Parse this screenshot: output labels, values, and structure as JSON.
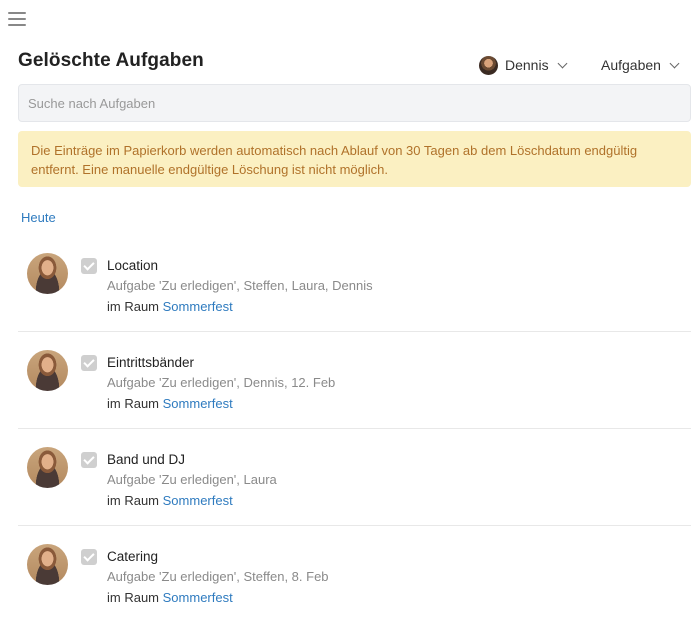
{
  "header": {
    "title": "Gelöschte Aufgaben",
    "user_filter": {
      "label": "Dennis"
    },
    "type_filter": {
      "label": "Aufgaben"
    }
  },
  "search": {
    "placeholder": "Suche nach Aufgaben",
    "value": ""
  },
  "notice": {
    "text": "Die Einträge im Papierkorb werden automatisch nach Ablauf von 30 Tagen ab dem Löschdatum endgültig entfernt. Eine manuelle endgültige Löschung ist nicht möglich."
  },
  "groups": [
    {
      "label": "Heute",
      "items": [
        {
          "title": "Location",
          "meta": "Aufgabe 'Zu erledigen', Steffen, Laura, Dennis",
          "room_prefix": "im Raum",
          "room": "Sommerfest"
        },
        {
          "title": "Eintrittsbänder",
          "meta": "Aufgabe 'Zu erledigen', Dennis, 12. Feb",
          "room_prefix": "im Raum",
          "room": "Sommerfest"
        },
        {
          "title": "Band und DJ",
          "meta": "Aufgabe 'Zu erledigen', Laura",
          "room_prefix": "im Raum",
          "room": "Sommerfest"
        },
        {
          "title": "Catering",
          "meta": "Aufgabe 'Zu erledigen', Steffen, 8. Feb",
          "room_prefix": "im Raum",
          "room": "Sommerfest"
        }
      ]
    }
  ],
  "colors": {
    "accent": "#2f7bbf",
    "notice_bg": "#fbf0c2",
    "notice_text": "#b0722a"
  },
  "icons": {
    "menu": "hamburger-icon",
    "dropdown": "chevron-down-icon",
    "done": "checkbox-checked-icon"
  }
}
